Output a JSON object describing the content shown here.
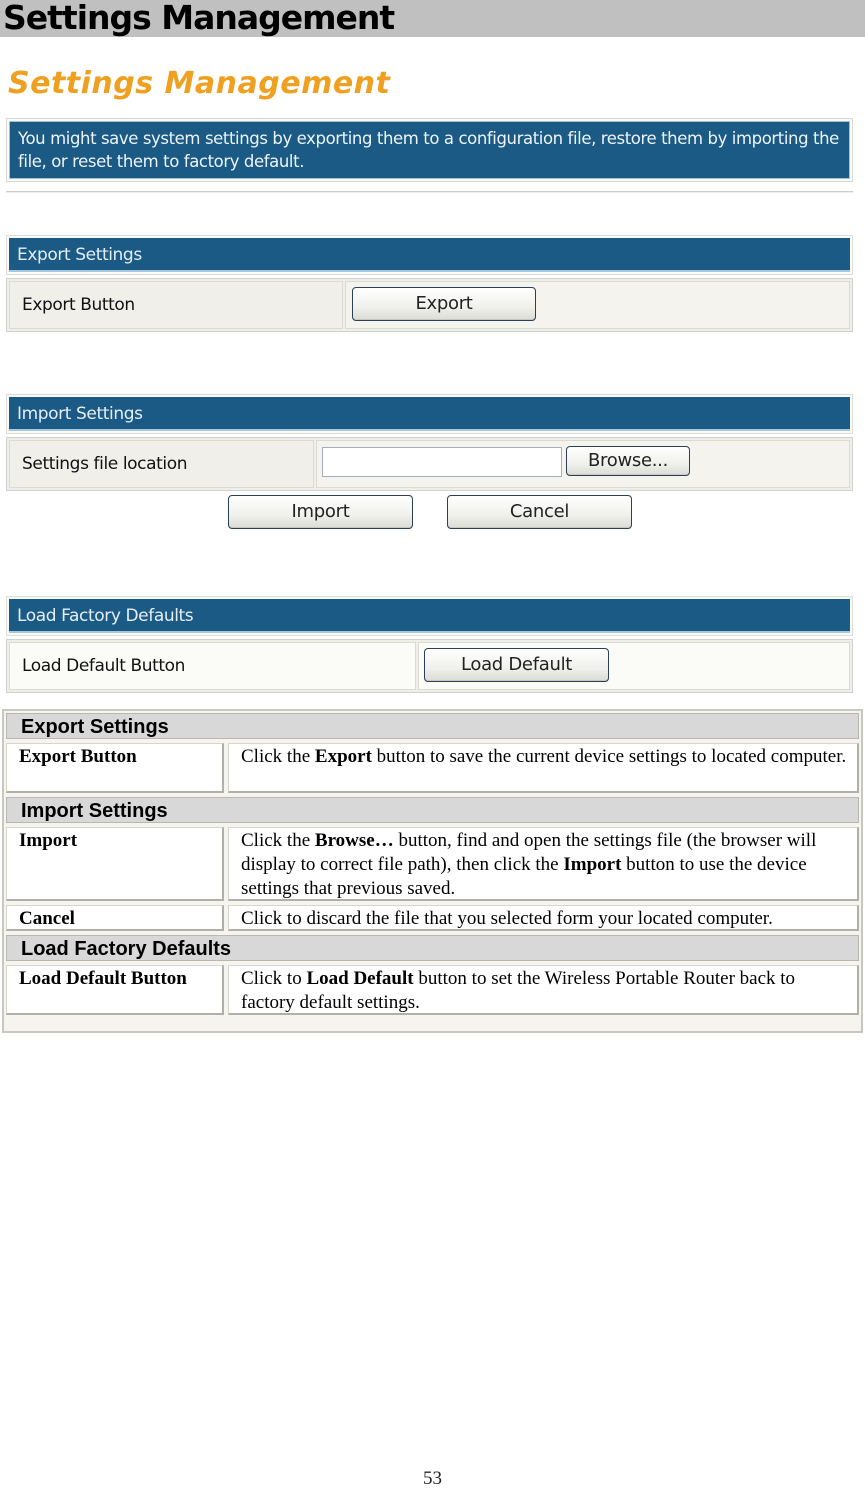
{
  "page": {
    "heading": "Settings Management",
    "page_number": "53"
  },
  "screenshot": {
    "title": "Settings Management",
    "intro": "You might save system settings by exporting them to a configuration file, restore them by importing the file, or reset them to factory default.",
    "title_color": "#f0a020",
    "header_color": "#1a5a85",
    "export": {
      "header": "Export Settings",
      "row_label": "Export Button",
      "button_label": "Export"
    },
    "import": {
      "header": "Import Settings",
      "row_label": "Settings file location",
      "file_input_value": "",
      "browse_label": "Browse...",
      "import_label": "Import",
      "cancel_label": "Cancel"
    },
    "factory": {
      "header": "Load Factory Defaults",
      "row_label": "Load Default Button",
      "button_label": "Load Default"
    }
  },
  "description_table": {
    "sections": [
      {
        "title": "Export Settings",
        "rows": [
          {
            "term": "Export Button",
            "parts": [
              {
                "text": "Click the ",
                "bold": false
              },
              {
                "text": "Export",
                "bold": true
              },
              {
                "text": " button to save the current device settings to located computer.",
                "bold": false
              }
            ]
          }
        ]
      },
      {
        "title": "Import Settings",
        "rows": [
          {
            "term": "Import",
            "parts": [
              {
                "text": "Click the ",
                "bold": false
              },
              {
                "text": "Browse…",
                "bold": true
              },
              {
                "text": " button, find and open the settings file (the browser will display to correct file path), then click the ",
                "bold": false
              },
              {
                "text": "Import",
                "bold": true
              },
              {
                "text": " button to use the device settings that previous saved.",
                "bold": false
              }
            ]
          },
          {
            "term": "Cancel",
            "parts": [
              {
                "text": "Click to discard the file that you selected form your located computer.",
                "bold": false
              }
            ]
          }
        ]
      },
      {
        "title": "Load Factory Defaults",
        "rows": [
          {
            "term": "Load Default Button",
            "parts": [
              {
                "text": "Click to ",
                "bold": false
              },
              {
                "text": "Load Default",
                "bold": true
              },
              {
                "text": " button to set the Wireless Portable Router back to factory default settings.",
                "bold": false
              }
            ]
          }
        ]
      }
    ]
  }
}
